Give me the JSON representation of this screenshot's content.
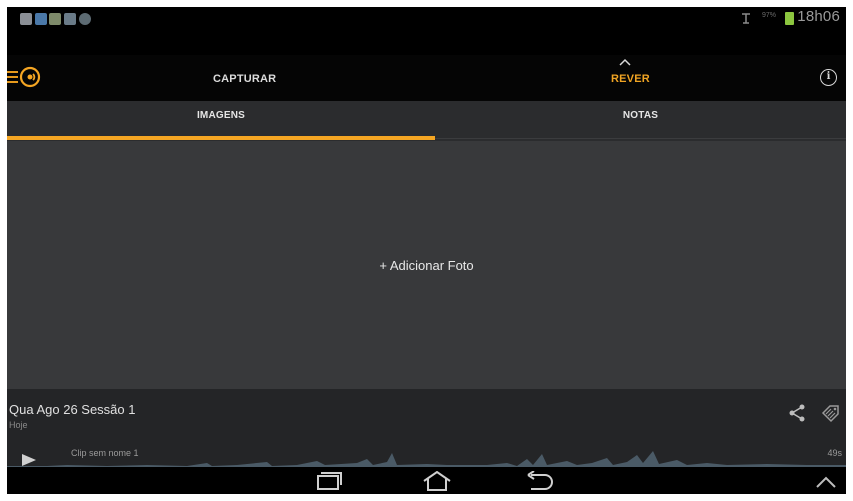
{
  "status_bar": {
    "time": "18h06",
    "battery_percent": "97%",
    "battery_color": "#8cc63f"
  },
  "action_bar": {
    "tabs": [
      {
        "label": "CAPTURAR",
        "active": false
      },
      {
        "label": "REVER",
        "active": true
      }
    ],
    "accent_color": "#f5a623",
    "icons": [
      "menu-icon",
      "logo-icon",
      "chevron-up-icon",
      "info-icon"
    ]
  },
  "sub_tabs": [
    {
      "label": "IMAGENS",
      "active": true
    },
    {
      "label": "NOTAS",
      "active": false
    }
  ],
  "content": {
    "add_photo_label": "+ Adicionar Foto"
  },
  "session": {
    "title": "Qua Ago 26 Sessão 1",
    "subtitle": "Hoje",
    "clip_name": "Clip sem nome 1",
    "clip_duration": "49s",
    "icons": [
      "share-icon",
      "tag-icon",
      "play-icon"
    ]
  },
  "nav_bar": {
    "icons": [
      "recent-apps-icon",
      "home-icon",
      "back-icon",
      "expand-up-icon"
    ]
  }
}
